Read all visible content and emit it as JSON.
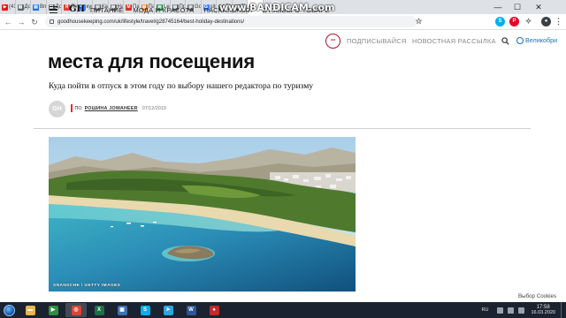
{
  "browser": {
    "tabs": [
      {
        "label": "(41",
        "favicon": "youtube",
        "color": "#ff0000",
        "glyph": "▶"
      },
      {
        "label": "Дос",
        "favicon": "page",
        "color": "#5f6368",
        "glyph": "▤"
      },
      {
        "label": "Впл",
        "favicon": "page",
        "color": "#1a73e8",
        "glyph": "▤"
      },
      {
        "label": "Дос",
        "favicon": "page",
        "color": "#5f6368",
        "glyph": "▤"
      },
      {
        "label": "Ян",
        "favicon": "yandex",
        "color": "#e53935",
        "glyph": "Я"
      },
      {
        "label": "куп",
        "favicon": "google",
        "color": "#4285f4",
        "glyph": "G"
      },
      {
        "label": "Кар",
        "favicon": "page",
        "color": "#5f6368",
        "glyph": "▤"
      },
      {
        "label": "Нас",
        "favicon": "page",
        "color": "#5f6368",
        "glyph": "▤"
      },
      {
        "label": "Пар",
        "favicon": "gmail",
        "color": "#d93025",
        "glyph": "M"
      },
      {
        "label": "Пар",
        "favicon": "page",
        "color": "#e8710a",
        "glyph": "▤"
      },
      {
        "label": "Les",
        "favicon": "page",
        "color": "#188038",
        "glyph": "▤"
      },
      {
        "label": "Про",
        "favicon": "page",
        "color": "#5f6368",
        "glyph": "▤"
      },
      {
        "label": "Goo",
        "favicon": "page",
        "color": "#5f6368",
        "glyph": "▤"
      },
      {
        "label": "site",
        "favicon": "google",
        "color": "#4285f4",
        "glyph": "G"
      },
      {
        "label": "The",
        "favicon": "page",
        "color": "#5f6368",
        "glyph": "T"
      },
      {
        "label": "The",
        "favicon": "page",
        "color": "#5f6368",
        "glyph": "▤"
      },
      {
        "label": "",
        "favicon": "page",
        "color": "#5f6368",
        "glyph": "▤"
      }
    ],
    "active_tab_index": 16,
    "new_tab_glyph": "+",
    "window_controls": {
      "minimize": "—",
      "maximize": "☐",
      "close": "✕"
    },
    "url": "goodhousekeeping.com/uk/lifestyle/travel/g28745164/best-holiday-destinations/",
    "nav_glyphs": {
      "back": "←",
      "forward": "→",
      "reload": "↻"
    },
    "extensions": [
      {
        "name": "star-icon",
        "glyph": "☆",
        "color": "#5f6368"
      },
      {
        "name": "skype-extension-icon",
        "glyph": "S",
        "color": "#00aff0"
      },
      {
        "name": "pinterest-extension-icon",
        "glyph": "P",
        "color": "#e60023"
      },
      {
        "name": "extension-puzzle-icon",
        "glyph": "✧",
        "color": "#5f6368"
      },
      {
        "name": "profile-avatar-icon",
        "glyph": "●",
        "color": "#3c4043"
      },
      {
        "name": "more-menu-icon",
        "glyph": "⋮",
        "color": "#5f6368"
      }
    ]
  },
  "overlay": {
    "watermark_url": "www.BANDICAM.com"
  },
  "site": {
    "logo": "GH",
    "nav": [
      "ПИТАНИЕ",
      "МОДА И КРАСОТА",
      "ПАСХАЛЬНЫЙ",
      "ОТЗЫВЫ О ТОВАРЕ"
    ],
    "seal_text": "Good Housekeeping Institute",
    "subscribe": "ПОДПИСЫВАЙСЯ",
    "newsletter": "НОВОСТНАЯ РАССЫЛКА",
    "region": "Великобри"
  },
  "article": {
    "title": "места для посещения",
    "dek": "Куда пойти в отпуск в этом году по выбору нашего редактора по туризму",
    "avatar_initials": "GH",
    "by": "ПО",
    "author": "РОШИНА JOWAHEER",
    "date": "07/12/2019",
    "image_credit": "SNANSCHE / GETTY IMAGES"
  },
  "footer": {
    "cookies": "Выбор Cookies"
  },
  "taskbar": {
    "apps": [
      {
        "name": "explorer-icon",
        "glyph": "▬",
        "color": "#e8b64c"
      },
      {
        "name": "media-player-icon",
        "glyph": "▶",
        "color": "#2f8f3f"
      },
      {
        "name": "chrome-icon",
        "glyph": "◎",
        "color": "#db4437"
      },
      {
        "name": "excel-icon",
        "glyph": "X",
        "color": "#1d7044"
      },
      {
        "name": "bandicam-icon",
        "glyph": "▣",
        "color": "#3e6fb5"
      },
      {
        "name": "skype-icon",
        "glyph": "S",
        "color": "#00aff0"
      },
      {
        "name": "telegram-icon",
        "glyph": "➤",
        "color": "#2ca5e0"
      },
      {
        "name": "word-icon",
        "glyph": "W",
        "color": "#2b579a"
      },
      {
        "name": "recorder-icon",
        "glyph": "●",
        "color": "#c62828"
      }
    ],
    "active_app_index": 2,
    "lang": "RU",
    "time": "17:58",
    "date": "16.03.2020"
  }
}
